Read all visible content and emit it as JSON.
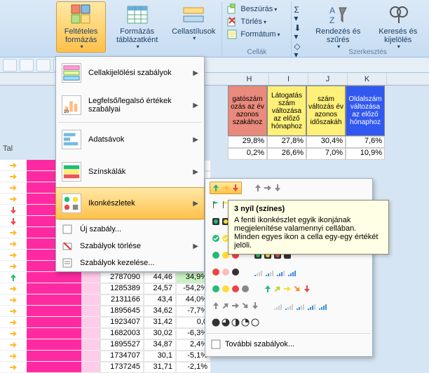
{
  "ribbon": {
    "cond_fmt": "Feltételes\nformázás",
    "fmt_table": "Formázás\ntáblázatként",
    "cell_styles": "Cellastílusok",
    "insert": "Beszúrás",
    "delete": "Törlés",
    "format": "Formátum",
    "group_cells": "Cellák",
    "sort_filter": "Rendezés\nés szűrés",
    "find_select": "Keresés és\nkijelölés",
    "group_edit": "Szerkesztés"
  },
  "menu": {
    "highlight": "Cellakijelölési szabályok",
    "topbottom": "Legfelső/legalsó értékek szabályai",
    "databars": "Adatsávok",
    "colorscales": "Színskálák",
    "iconsets": "Ikonkészletek",
    "newrule": "Új szabály...",
    "clear": "Szabályok törlése",
    "manage": "Szabályok kezelése..."
  },
  "tooltip": {
    "title": "3 nyíl (színes)",
    "body": "A fenti ikonkészlet egyik ikonjának megjelenítése valamennyi cellában. Minden egyes ikon a cella egy-egy értékét jelöli."
  },
  "flyout_more": "További szabályok...",
  "col_letters": [
    "H",
    "I",
    "J",
    "K"
  ],
  "header_cells": [
    {
      "cls": "h-red",
      "text": "gatószám ozás az év azonos szakához"
    },
    {
      "cls": "h-yel",
      "text": "Látogatás szám változása az előző hónaphoz"
    },
    {
      "cls": "h-yel",
      "text": "szám változás év azonos időszakáh"
    },
    {
      "cls": "h-blue",
      "text": "Oldalszám változása az előző hónaphoz"
    }
  ],
  "pct_rows": [
    [
      "29,8%",
      "27,8%",
      "30,4%",
      "7,6%"
    ],
    [
      "0,2%",
      "26,6%",
      "7,0%",
      "10,9%"
    ]
  ],
  "left_label": "Tal",
  "grid_rows": [
    {
      "icon": "right",
      "num1": "",
      "num2": "",
      "num3": ""
    },
    {
      "icon": "right",
      "num1": "",
      "num2": "",
      "num3": ""
    },
    {
      "icon": "right",
      "num1": "",
      "num2": "",
      "num3": ""
    },
    {
      "icon": "right",
      "num1": "",
      "num2": "",
      "num3": ""
    },
    {
      "icon": "down",
      "num1": "",
      "num2": "",
      "num3": ""
    },
    {
      "icon": "down",
      "num1": "",
      "num2": "",
      "num3": ""
    },
    {
      "icon": "right",
      "num1": "",
      "num2": "",
      "num3": ""
    },
    {
      "icon": "right",
      "num1": "",
      "num2": "",
      "num3": ""
    },
    {
      "icon": "right",
      "num1": "",
      "num2": "",
      "num3": ""
    },
    {
      "icon": "right",
      "num1": "",
      "num2": "",
      "num3": ""
    },
    {
      "icon": "up",
      "num1": "2787090",
      "num2": "44,46",
      "num3": "34,9%",
      "cls": "green"
    },
    {
      "icon": "right",
      "num1": "1285389",
      "num2": "24,57",
      "num3": "-54,2%"
    },
    {
      "icon": "right",
      "num1": "2131166",
      "num2": "43,4",
      "num3": "44,0%"
    },
    {
      "icon": "right",
      "num1": "1895645",
      "num2": "34,62",
      "num3": "-7,7%"
    },
    {
      "icon": "right",
      "num1": "1923407",
      "num2": "31,42",
      "num3": "0,0"
    },
    {
      "icon": "right",
      "num1": "1682003",
      "num2": "30,02",
      "num3": "-6,3%"
    },
    {
      "icon": "right",
      "num1": "1895527",
      "num2": "34,87",
      "num3": "2,4%"
    },
    {
      "icon": "right",
      "num1": "1734707",
      "num2": "30,1",
      "num3": "-5,1%"
    },
    {
      "icon": "right",
      "num1": "1737245",
      "num2": "31,71",
      "num3": "-2,1%"
    }
  ],
  "chart_data": {
    "type": "table",
    "title": "",
    "columns": [
      "value",
      "metric",
      "pct_change"
    ],
    "rows": [
      [
        2787090,
        44.46,
        34.9
      ],
      [
        1285389,
        24.57,
        -54.2
      ],
      [
        2131166,
        43.4,
        44.0
      ],
      [
        1895645,
        34.62,
        -7.7
      ],
      [
        1923407,
        31.42,
        0.0
      ],
      [
        1682003,
        30.02,
        -6.3
      ],
      [
        1895527,
        34.87,
        2.4
      ],
      [
        1734707,
        30.1,
        -5.1
      ],
      [
        1737245,
        31.71,
        -2.1
      ]
    ]
  }
}
